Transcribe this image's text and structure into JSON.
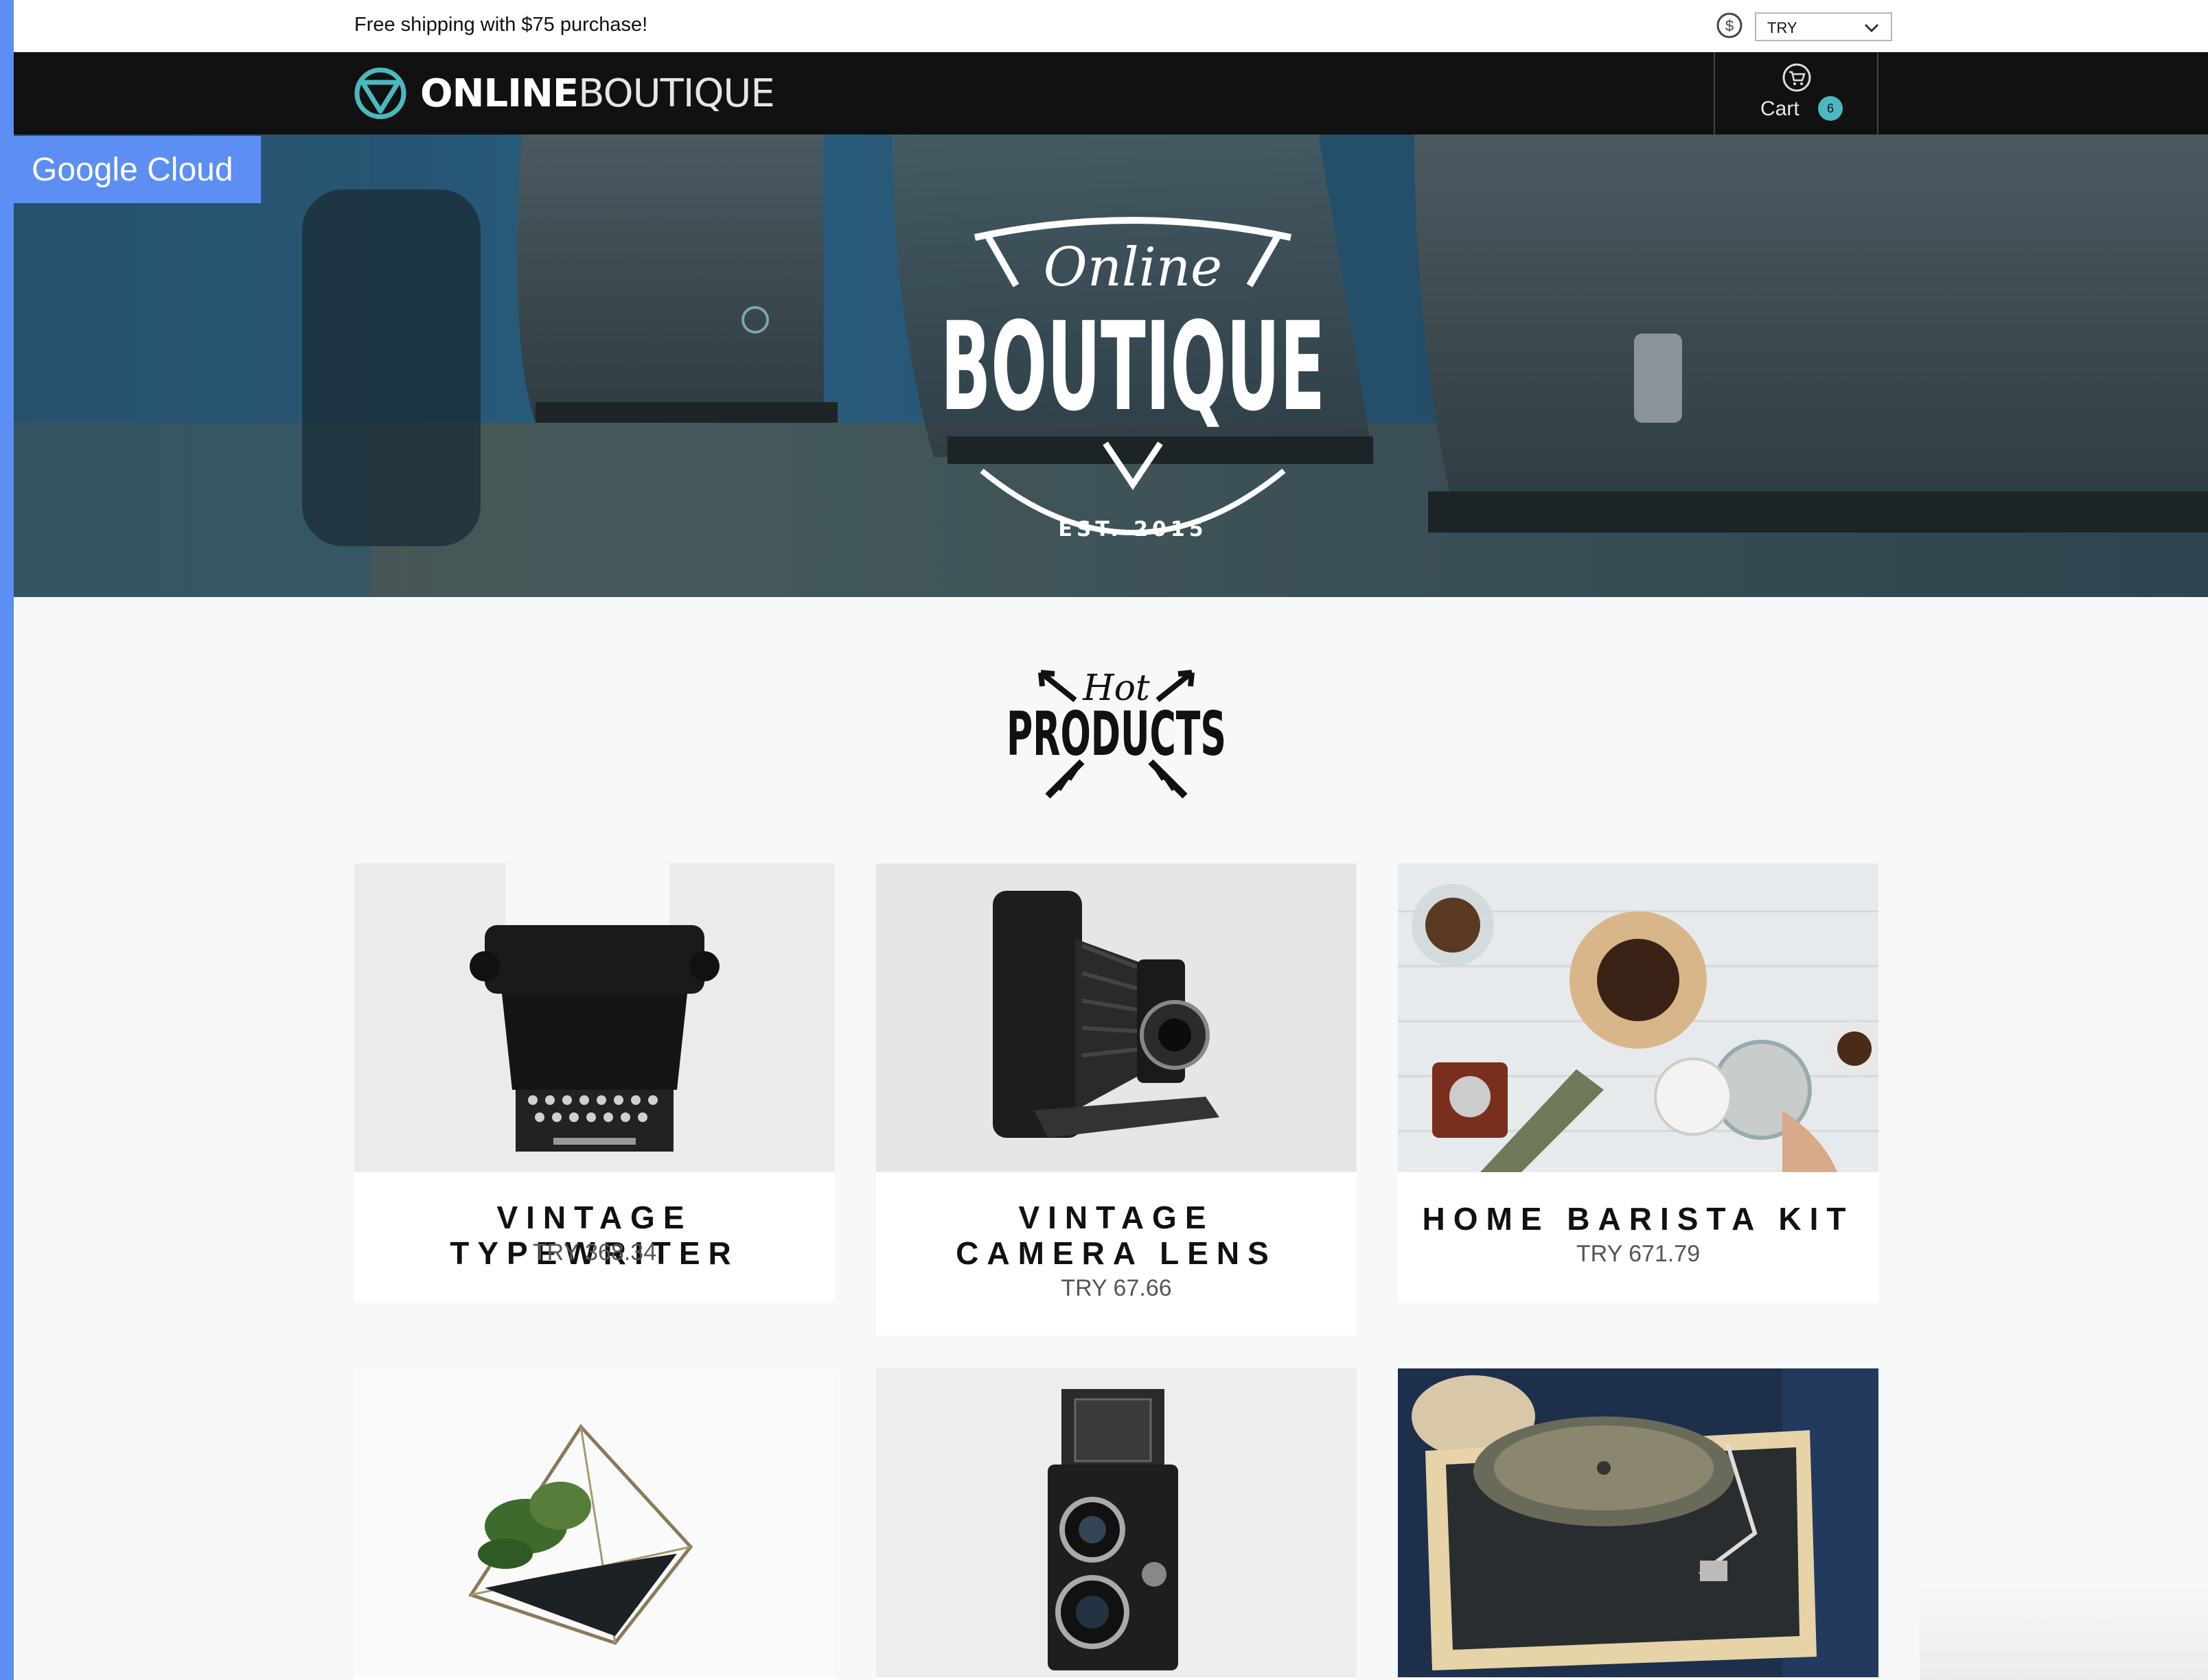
{
  "topbar": {
    "promo": "Free shipping with $75 purchase!",
    "currency_icon": "dollar-circle-icon",
    "currency_selected": "TRY"
  },
  "header": {
    "logo_bold": "ONLINE",
    "logo_thin": "BOUTIQUE",
    "cart_label": "Cart",
    "cart_count": "6",
    "cart_icon": "cart-icon"
  },
  "gc_tab": {
    "label": "Google Cloud"
  },
  "hero": {
    "line1": "Online",
    "line2": "BOUTIQUE",
    "est": "EST. 2015"
  },
  "hot_products": {
    "line1": "Hot",
    "line2": "PRODUCTS"
  },
  "products": [
    {
      "name": "VINTAGE TYPEWRITER",
      "price": "TRY 368.34"
    },
    {
      "name": "VINTAGE CAMERA LENS",
      "price": "TRY 67.66"
    },
    {
      "name": "HOME BARISTA KIT",
      "price": "TRY 671.79"
    },
    {
      "name": "",
      "price": ""
    },
    {
      "name": "",
      "price": ""
    },
    {
      "name": "",
      "price": ""
    }
  ],
  "colors": {
    "accent": "#5c8ef3",
    "header_bg": "#111111",
    "badge": "#4bb8c1",
    "page_bg": "#f7f8fa"
  }
}
